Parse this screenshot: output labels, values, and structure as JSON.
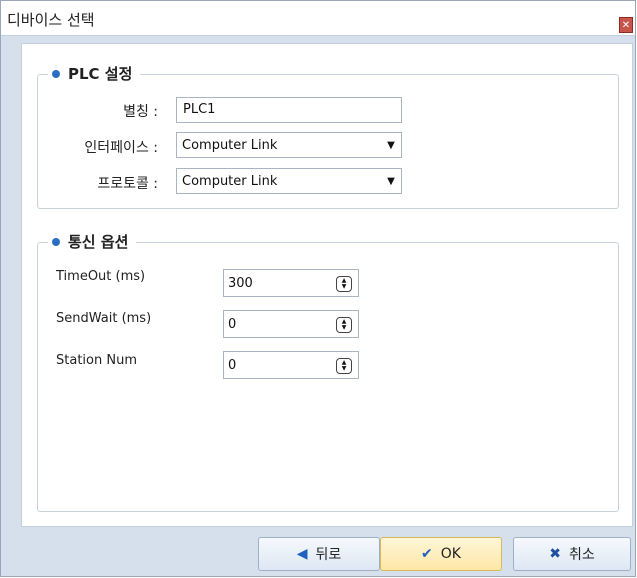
{
  "window": {
    "title": "디바이스 선택",
    "close_glyph": "✕"
  },
  "plc_group": {
    "title": "PLC 설정",
    "alias_label": "별칭 :",
    "alias_value": "PLC1",
    "interface_label": "인터페이스 :",
    "interface_value": "Computer Link",
    "protocol_label": "프로토콜 :",
    "protocol_value": "Computer Link"
  },
  "comm_group": {
    "title": "통신 옵션",
    "timeout_label": "TimeOut (ms)",
    "timeout_value": "300",
    "sendwait_label": "SendWait (ms)",
    "sendwait_value": "0",
    "station_label": "Station Num",
    "station_value": "0"
  },
  "buttons": {
    "back": "뒤로",
    "ok": "OK",
    "cancel": "취소"
  },
  "colors": {
    "accent": "#2a6ec4",
    "ok_highlight": "#fde7a6",
    "back_arrow": "#1f5fbf",
    "ok_check": "#1f5fbf",
    "cancel_x": "#1f4f9f"
  }
}
